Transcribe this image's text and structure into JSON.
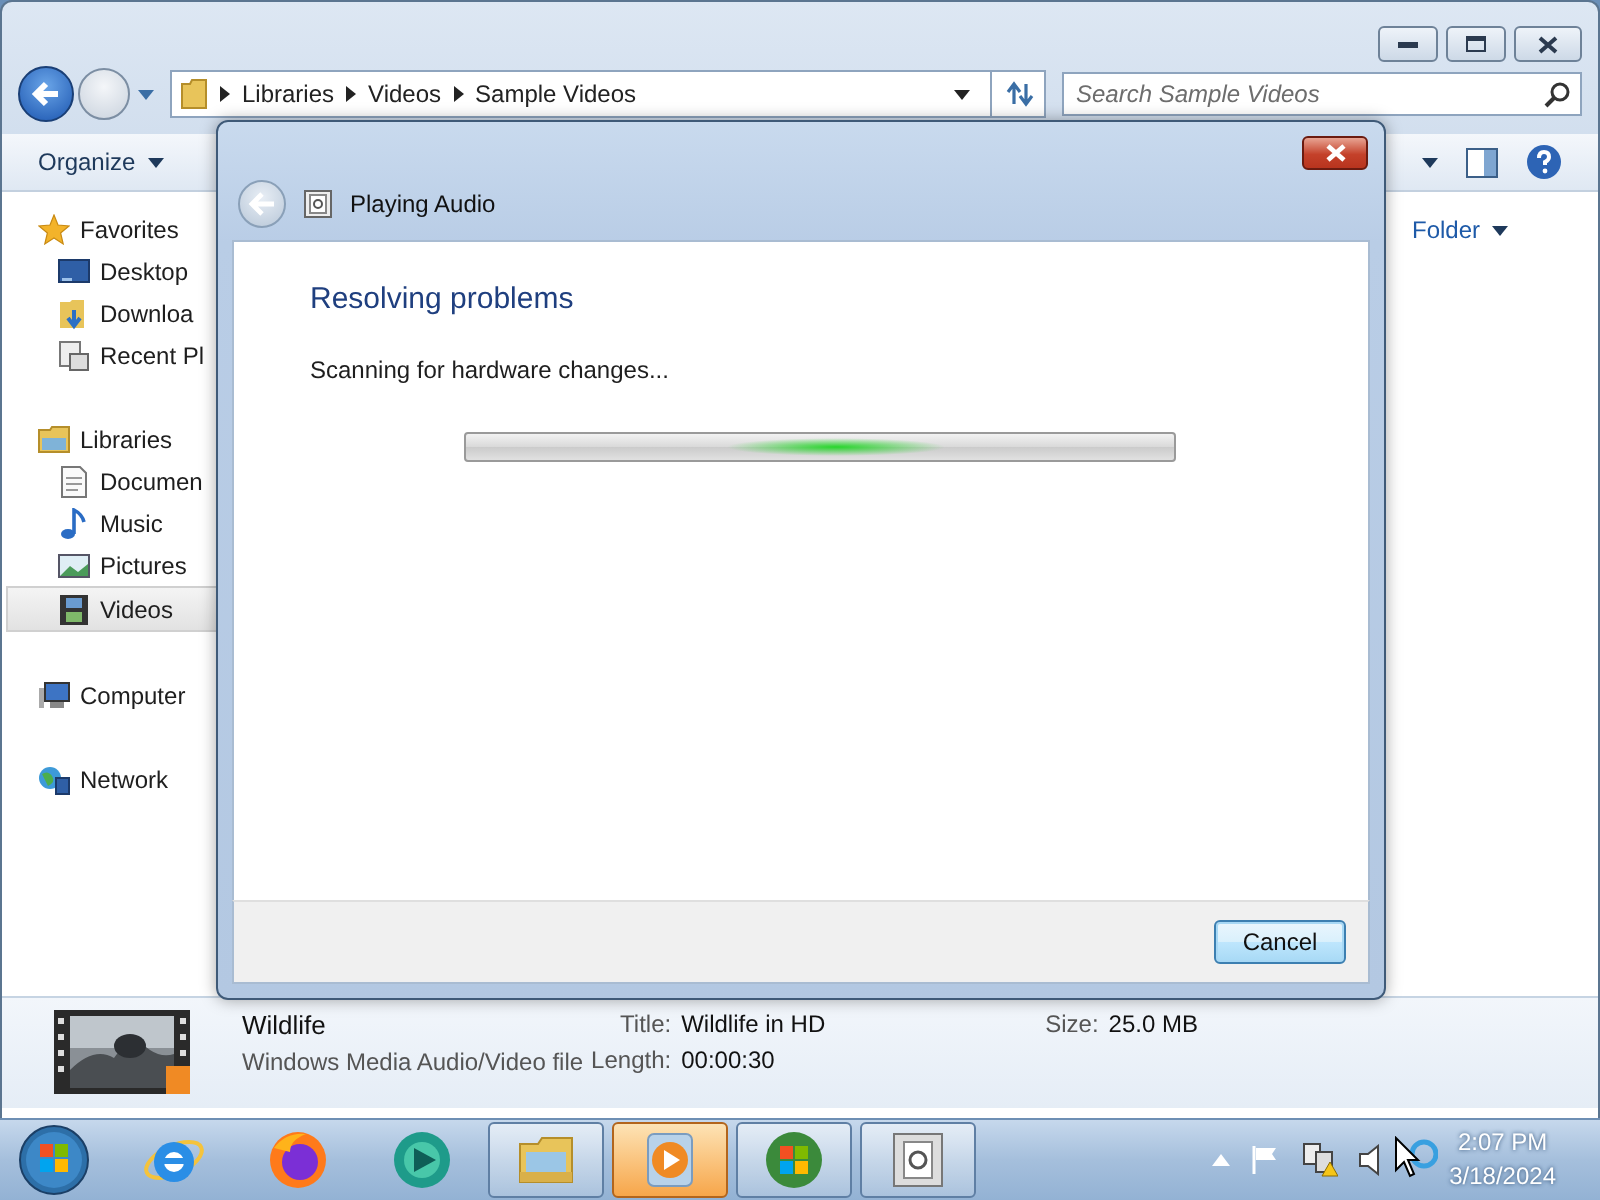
{
  "explorer": {
    "nav_buttons": {
      "back_enabled": true,
      "forward_enabled": false
    },
    "address": [
      "Libraries",
      "Videos",
      "Sample Videos"
    ],
    "search": {
      "placeholder": "Search Sample Videos"
    },
    "toolbar": {
      "organize": "Organize"
    },
    "arrange": "Folder",
    "nav": [
      {
        "label": "Favorites",
        "selected": false,
        "children": [
          {
            "label": "Desktop",
            "selected": false
          },
          {
            "label": "Downloa",
            "selected": false
          },
          {
            "label": "Recent Pl",
            "selected": false
          }
        ]
      },
      {
        "label": "Libraries",
        "selected": false,
        "children": [
          {
            "label": "Documen",
            "selected": false
          },
          {
            "label": "Music",
            "selected": false
          },
          {
            "label": "Pictures",
            "selected": false
          },
          {
            "label": "Videos",
            "selected": true
          }
        ]
      },
      {
        "label": "Computer",
        "selected": false
      },
      {
        "label": "Network",
        "selected": false
      }
    ],
    "details": {
      "name": "Wildlife",
      "type": "Windows Media Audio/Video file",
      "columns": [
        [
          {
            "label": "Title:",
            "value": "Wildlife in HD"
          },
          {
            "label": "Length:",
            "value": "00:00:30"
          }
        ],
        [
          {
            "label": "Size:",
            "value": "25.0 MB"
          }
        ]
      ]
    }
  },
  "dialog": {
    "title": "Playing Audio",
    "back_enabled": false,
    "heading": "Resolving problems",
    "status": "Scanning for hardware changes...",
    "progress": {
      "kind": "marquee"
    },
    "buttons": [
      {
        "label": "Cancel",
        "default": true
      }
    ]
  },
  "taskbar": {
    "items": [
      {
        "open": false,
        "active": false
      },
      {
        "open": false,
        "active": false
      },
      {
        "open": false,
        "active": false
      },
      {
        "open": true,
        "active": false
      },
      {
        "open": true,
        "active": true
      },
      {
        "open": true,
        "active": false
      },
      {
        "open": true,
        "active": false
      }
    ],
    "clock": {
      "time": "2:07 PM",
      "date": "3/18/2024"
    }
  }
}
